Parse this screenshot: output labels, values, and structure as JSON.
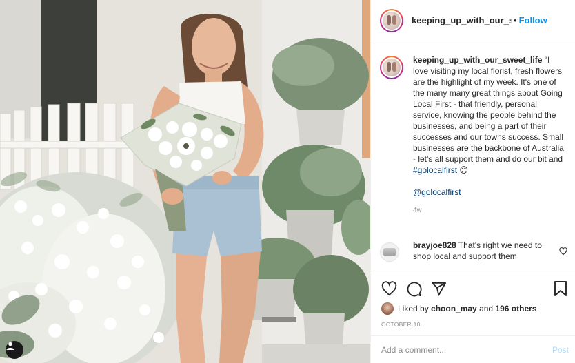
{
  "post": {
    "username": "keeping_up_with_our_swe",
    "separator": "•",
    "follow_label": "Follow"
  },
  "caption": {
    "username": "keeping_up_with_our_sweet_life",
    "text": "\"I love visiting my local florist, fresh flowers are the highlight of my week. It's one of the many many great things about Going Local First - that friendly, personal service, knowing the people behind the businesses, and being a part of their successes and our towns success. Small businesses are the backbone of Australia - let's all support them and do our bit and",
    "hashtag": "#golocalfirst",
    "emoji": "😊",
    "mention": "@golocalfirst",
    "time": "4w"
  },
  "comment": {
    "username": "brayjoe828",
    "text": "That's right we need to shop local and support them"
  },
  "likes": {
    "prefix": "Liked by",
    "user": "choon_may",
    "connector": "and",
    "others": "196 others"
  },
  "date": "OCTOBER 10",
  "add_comment": {
    "placeholder": "Add a comment...",
    "post_label": "Post"
  },
  "colors": {
    "accent": "#0095f6",
    "post_disabled": "#b2dffc",
    "link": "#00376b",
    "muted": "#8e8e8e"
  },
  "icons": [
    "user-tag-icon",
    "heart-icon",
    "comment-icon",
    "share-icon",
    "bookmark-icon",
    "heart-small-icon"
  ]
}
